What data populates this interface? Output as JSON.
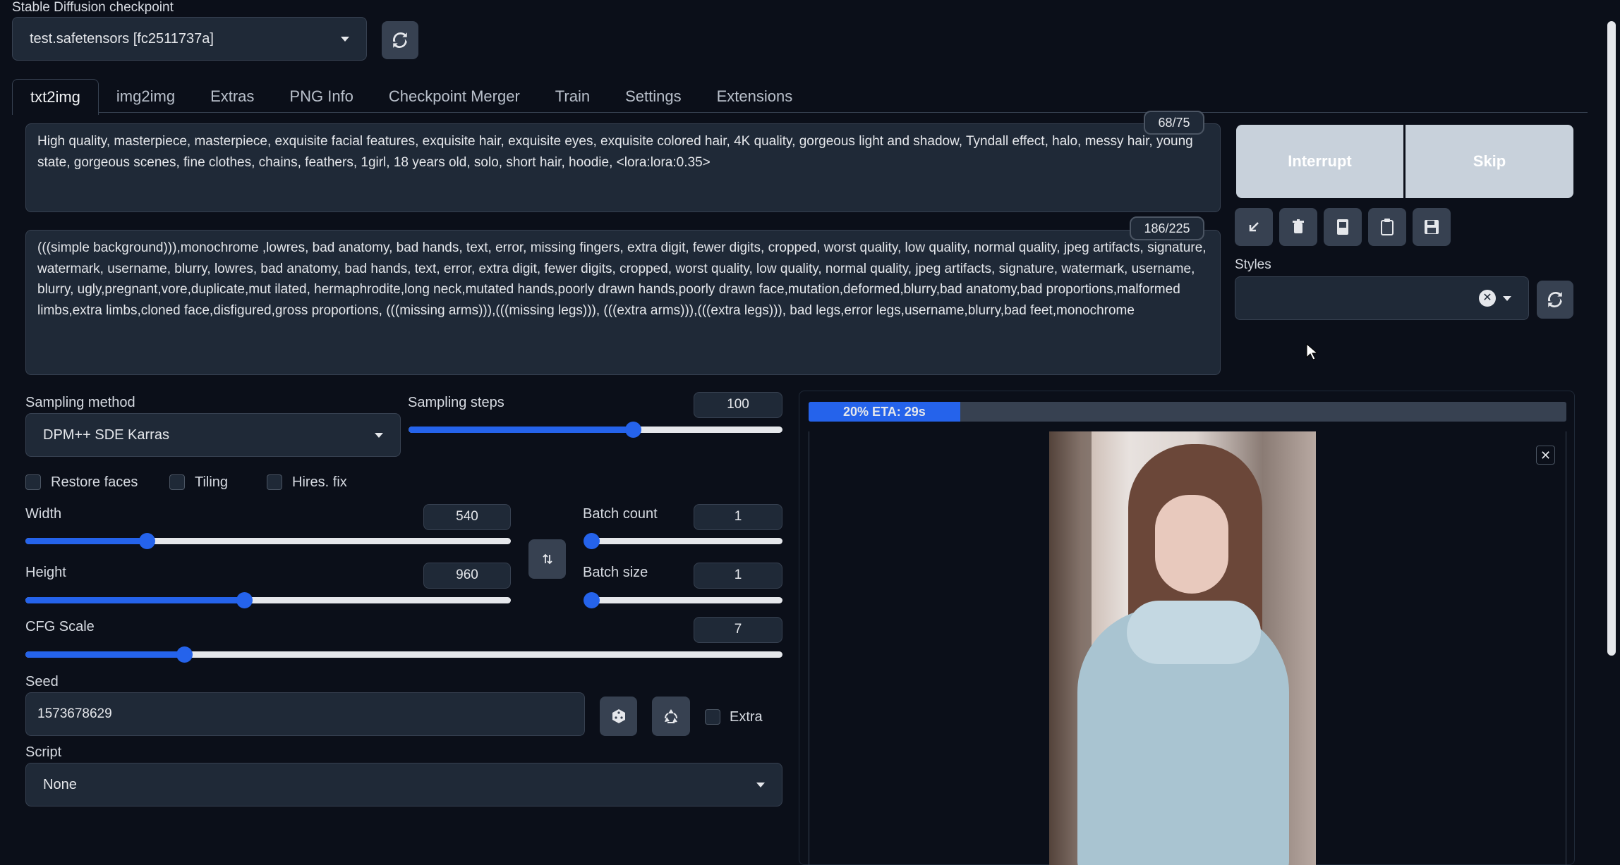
{
  "checkpoint": {
    "label": "Stable Diffusion checkpoint",
    "value": "test.safetensors [fc2511737a]"
  },
  "tabs": [
    {
      "label": "txt2img"
    },
    {
      "label": "img2img"
    },
    {
      "label": "Extras"
    },
    {
      "label": "PNG Info"
    },
    {
      "label": "Checkpoint Merger"
    },
    {
      "label": "Train"
    },
    {
      "label": "Settings"
    },
    {
      "label": "Extensions"
    }
  ],
  "prompt": {
    "counter": "68/75",
    "text": "High quality, masterpiece, masterpiece, exquisite facial features, exquisite hair, exquisite eyes, exquisite colored hair, 4K quality, gorgeous light and shadow, Tyndall effect, halo, messy hair, young state, gorgeous scenes, fine clothes, chains, feathers, 1girl, 18 years old, solo, short hair, hoodie, <lora:lora:0.35>"
  },
  "negative_prompt": {
    "counter": "186/225",
    "text": "(((simple background))),monochrome ,lowres, bad anatomy, bad hands, text, error, missing fingers, extra digit, fewer digits, cropped, worst quality, low quality, normal quality, jpeg artifacts, signature, watermark, username, blurry, lowres, bad anatomy, bad hands, text, error, extra digit, fewer digits, cropped, worst quality, low quality, normal quality, jpeg artifacts, signature, watermark, username, blurry, ugly,pregnant,vore,duplicate,mut ilated, hermaphrodite,long neck,mutated hands,poorly drawn hands,poorly drawn face,mutation,deformed,blurry,bad anatomy,bad proportions,malformed limbs,extra limbs,cloned face,disfigured,gross proportions, (((missing arms))),(((missing legs))), (((extra arms))),(((extra legs))), bad legs,error legs,username,blurry,bad feet,monochrome"
  },
  "actions": {
    "interrupt": "Interrupt",
    "skip": "Skip"
  },
  "styles": {
    "label": "Styles",
    "value": ""
  },
  "sampling": {
    "method_label": "Sampling method",
    "method_value": "DPM++ SDE Karras",
    "steps_label": "Sampling steps",
    "steps_value": "100",
    "steps_fraction": 0.6
  },
  "checkboxes": {
    "restore_faces": "Restore faces",
    "tiling": "Tiling",
    "hires_fix": "Hires. fix",
    "extra": "Extra"
  },
  "width": {
    "label": "Width",
    "value": "540",
    "fraction": 0.25
  },
  "height": {
    "label": "Height",
    "value": "960",
    "fraction": 0.45
  },
  "batch_count": {
    "label": "Batch count",
    "value": "1",
    "fraction": 0.0
  },
  "batch_size": {
    "label": "Batch size",
    "value": "1",
    "fraction": 0.0
  },
  "cfg": {
    "label": "CFG Scale",
    "value": "7",
    "fraction": 0.21
  },
  "seed": {
    "label": "Seed",
    "value": "1573678629"
  },
  "script": {
    "label": "Script",
    "value": "None"
  },
  "progress": {
    "text": "20% ETA: 29s",
    "fraction": 0.2
  },
  "colors": {
    "accent": "#2563eb",
    "background": "#0b0f19",
    "panel": "#1f2937"
  }
}
